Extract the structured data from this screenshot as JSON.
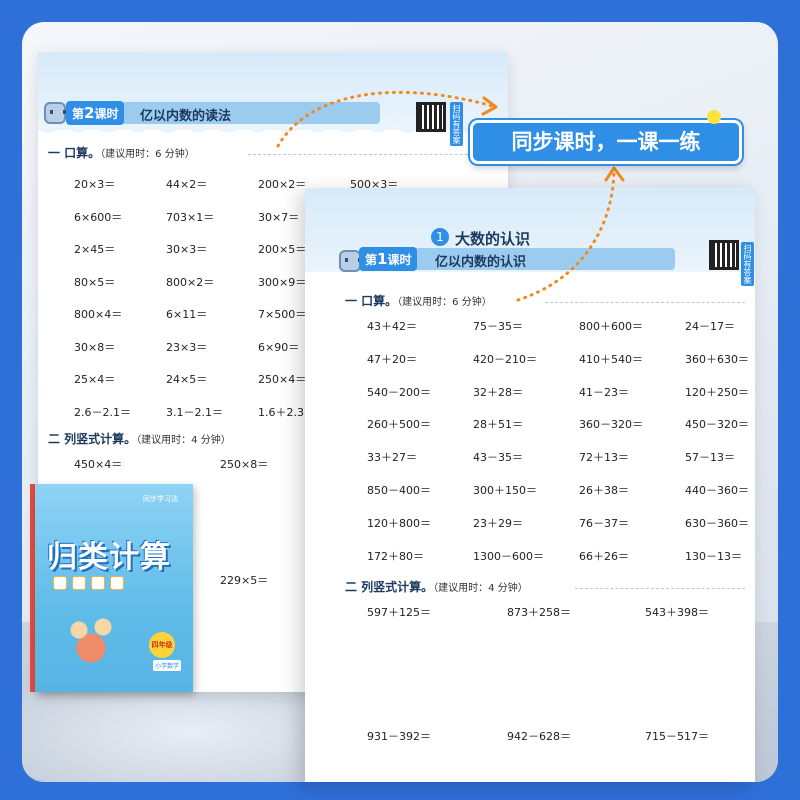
{
  "callout": {
    "text": "同步课时，一课一练"
  },
  "back_sheet": {
    "lesson_tag_prefix": "第",
    "lesson_num": "2",
    "lesson_tag_suffix": "课时",
    "lesson_title": "亿以内数的读法",
    "qr_label": "扫码有答案",
    "section1": {
      "label": "一  口算。",
      "hint": "（建议用时：6 分钟）"
    },
    "oral": [
      [
        "20×3＝",
        "44×2＝",
        "200×2＝",
        "500×3＝"
      ],
      [
        "6×600＝",
        "703×1＝",
        "30×7＝"
      ],
      [
        "2×45＝",
        "30×3＝",
        "200×5＝"
      ],
      [
        "80×5＝",
        "800×2＝",
        "300×9＝"
      ],
      [
        "800×4＝",
        "6×11＝",
        "7×500＝"
      ],
      [
        "30×8＝",
        "23×3＝",
        "6×90＝"
      ],
      [
        "25×4＝",
        "24×5＝",
        "250×4＝"
      ],
      [
        "2.6－2.1＝",
        "3.1－2.1＝",
        "1.6＋2.3＝"
      ]
    ],
    "section2": {
      "label": "二  列竖式计算。",
      "hint": "（建议用时：4 分钟）"
    },
    "vertical": [
      "450×4＝",
      "250×8＝",
      "229×5＝"
    ]
  },
  "front_sheet": {
    "unit_num": "1",
    "unit_title": "大数的认识",
    "lesson_tag_prefix": "第",
    "lesson_num": "1",
    "lesson_tag_suffix": "课时",
    "lesson_title": "亿以内数的认识",
    "qr_label": "扫码有答案",
    "section1": {
      "label": "一  口算。",
      "hint": "（建议用时：6 分钟）"
    },
    "oral": [
      [
        "43＋42＝",
        "75－35＝",
        "800＋600＝",
        "24－17＝"
      ],
      [
        "47＋20＝",
        "420－210＝",
        "410＋540＝",
        "360＋630＝"
      ],
      [
        "540－200＝",
        "32＋28＝",
        "41－23＝",
        "120＋250＝"
      ],
      [
        "260＋500＝",
        "28＋51＝",
        "360－320＝",
        "450－320＝"
      ],
      [
        "33＋27＝",
        "43－35＝",
        "72＋13＝",
        "57－13＝"
      ],
      [
        "850－400＝",
        "300＋150＝",
        "26＋38＝",
        "440－360＝"
      ],
      [
        "120＋800＝",
        "23＋29＝",
        "76－37＝",
        "630－360＝"
      ],
      [
        "172＋80＝",
        "1300－600＝",
        "66＋26＝",
        "130－13＝"
      ]
    ],
    "section2": {
      "label": "二  列竖式计算。",
      "hint": "（建议用时：4 分钟）"
    },
    "vertical_row1": [
      "597＋125＝",
      "873＋258＝",
      "543＋398＝"
    ],
    "vertical_row2": [
      "931－392＝",
      "942－628＝",
      "715－517＝"
    ]
  },
  "book": {
    "brand": "同步学习法",
    "title": "归类计算",
    "grade": "四年级",
    "subject": "小学数学"
  },
  "colors": {
    "accent": "#2f8ee6",
    "frame": "#2f6fd8",
    "arrow": "#f08a1c",
    "highlight": "#ffe23a"
  }
}
